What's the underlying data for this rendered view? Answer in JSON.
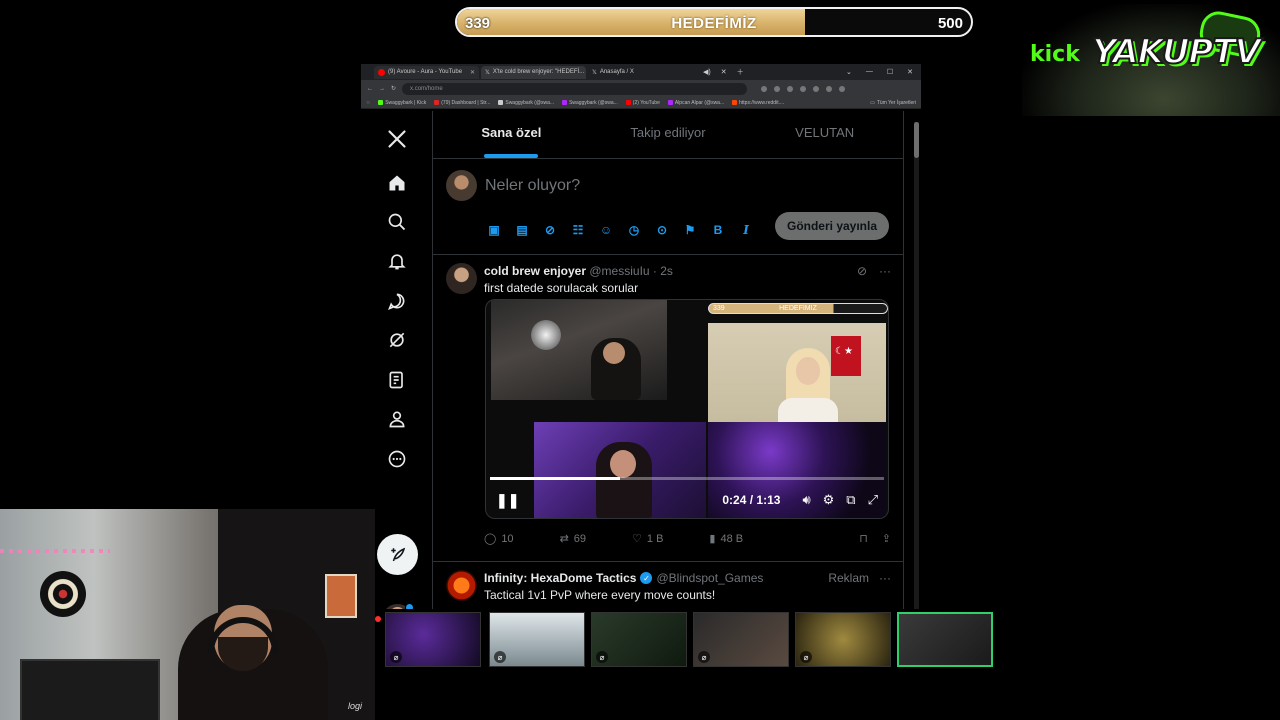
{
  "goal": {
    "current": "339",
    "title": "HEDEFİMİZ",
    "target": "500",
    "progress_fraction": 0.678
  },
  "overlay_logo": {
    "platform": "kick",
    "channel": "YAKUPTV"
  },
  "browser": {
    "tabs": [
      {
        "label": "(9) Avoure - Aura - YouTube",
        "favicon": "youtube-icon",
        "active": false
      },
      {
        "label": "X'te cold brew enjoyer: \"HEDEFİ...",
        "favicon": "x-icon",
        "active": true
      },
      {
        "label": "Anasayfa / X",
        "favicon": "x-icon",
        "active": false
      }
    ],
    "url": "x.com/home",
    "bookmarks": [
      {
        "label": "Swaggybark | Kick",
        "color": "#53fc18"
      },
      {
        "label": "(79) Dashboard | Str...",
        "color": "#e02424"
      },
      {
        "label": "Swaggybark (@swa...",
        "color": "#cccccc"
      },
      {
        "label": "Swaggybark (@swa...",
        "color": "#b026ff"
      },
      {
        "label": "(2) YouTube",
        "color": "#ff0000"
      },
      {
        "label": "Alpcan Alpar (@swa...",
        "color": "#b026ff"
      },
      {
        "label": "https://www.reddit....",
        "color": "#ff4500"
      }
    ],
    "bookmarks_folder": "Tüm Yer İşaretleri"
  },
  "x": {
    "feed_tabs": [
      "Sana özel",
      "Takip ediliyor",
      "VELUTAN"
    ],
    "active_tab_index": 0,
    "composer": {
      "placeholder": "Neler oluyor?",
      "post_button": "Gönderi yayınla"
    },
    "tweet": {
      "name": "cold brew enjoyer",
      "handle": "@messiuIu",
      "time": "· 2s",
      "text": "first datede sorulacak sorular",
      "video": {
        "overlay_start": "339",
        "overlay_title": "HEDEFİMİZ",
        "elapsed": "0:24",
        "duration": "1:13",
        "progress_fraction": 0.33
      },
      "stats": {
        "replies": "10",
        "reposts": "69",
        "likes": "1 B",
        "views": "48 B"
      }
    },
    "ad": {
      "name": "Infinity: HexaDome Tactics",
      "handle": "@Blindspot_Games",
      "label": "Reklam",
      "text": "Tactical 1v1 PvP where every move counts!"
    }
  },
  "webcam": {
    "brand_text": "logi"
  },
  "colors": {
    "x_blue": "#1d9bf0",
    "kick_green": "#53fc18",
    "gold": "#d8b26a",
    "selected_thumb": "#2fcf6a"
  }
}
